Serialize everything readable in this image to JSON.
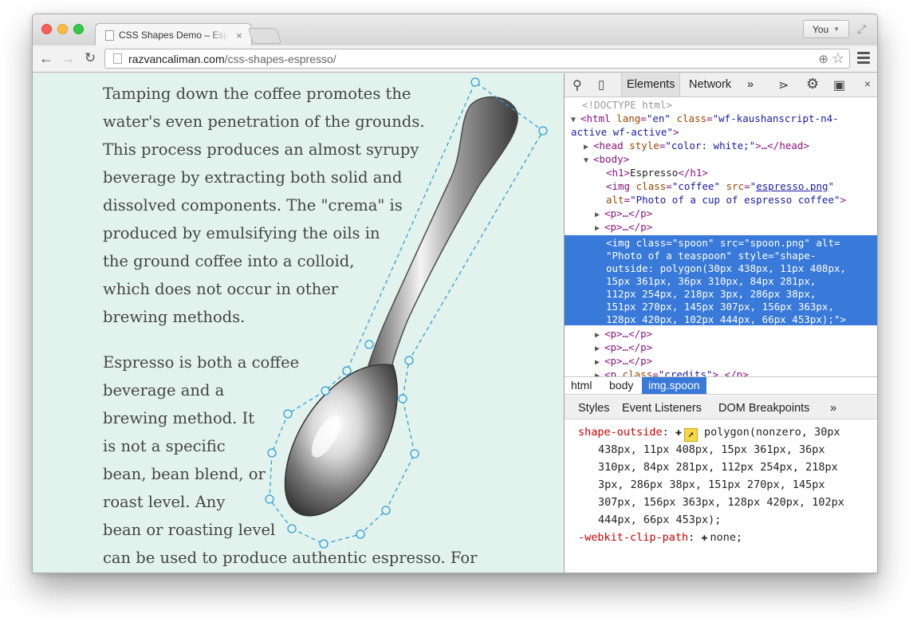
{
  "browser": {
    "tab_title": "CSS Shapes Demo – Espresso",
    "tab_close": "×",
    "profile_label": "You",
    "url_domain": "razvancaliman.com",
    "url_path": "/css-shapes-espresso/"
  },
  "article": {
    "p1_lines": [
      "Tamping down the coffee promotes the",
      "water's even penetration of the grounds.",
      "This process produces an almost syrupy",
      "beverage by extracting both solid and",
      "dissolved components. The \"crema\" is",
      "produced by emulsifying the oils in",
      "the ground coffee into a colloid,",
      "which does not occur in other",
      "brewing methods."
    ],
    "p2_lines": [
      "Espresso is both a coffee",
      "beverage and a",
      "brewing method. It",
      "is not a specific",
      "bean, bean blend, or",
      "roast level. Any",
      "bean or roasting level",
      "can be used to produce authentic espresso. For"
    ]
  },
  "devtools": {
    "tabs": [
      "Elements",
      "Network"
    ],
    "more": "»",
    "dom": {
      "doctype": "<!DOCTYPE html>",
      "html_open_1": "<html",
      "html_lang_attr": "lang",
      "html_lang_val": "\"en\"",
      "html_class_attr": "class",
      "html_class_val_1": "\"wf-kaushanscript-n4-",
      "html_class_val_2": "active wf-active\"",
      "head_open": "<head",
      "head_style_attr": "style",
      "head_style_val": "\"color: white;\"",
      "head_rest": ">…</head>",
      "body_open": "<body>",
      "h1_open": "<h1>",
      "h1_text": "Espresso",
      "h1_close": "</h1>",
      "img1_open": "<img",
      "img1_class_attr": "class",
      "img1_class_val": "\"coffee\"",
      "img1_src_attr": "src",
      "img1_src_val": "espresso.png",
      "img1_alt_attr": "alt",
      "img1_alt_val": "\"Photo of a cup of espresso coffee\"",
      "p_collapsed": "<p>…</p>",
      "sel_lines": [
        "<img class=\"spoon\" src=\"spoon.png\" alt=",
        "\"Photo of a teaspoon\" style=\"shape-",
        "outside: polygon(30px 438px, 11px 408px,",
        "15px 361px, 36px 310px, 84px 281px,",
        "112px 254px, 218px 3px, 286px 38px,",
        "151px 270px, 145px 307px, 156px 363px,",
        "128px 420px, 102px 444px, 66px 453px);\">"
      ],
      "p_credits_open": "<p",
      "p_credits_attr": "class",
      "p_credits_val": "\"credits\"",
      "p_credits_rest": ">…</p>"
    },
    "breadcrumbs": [
      "html",
      "body",
      "img.spoon"
    ],
    "style_tabs": [
      "Styles",
      "Event Listeners",
      "DOM Breakpoints"
    ],
    "styles": {
      "prop1": "shape-outside",
      "val1_lines": [
        "polygon(nonzero, 30px",
        "438px, 11px 408px, 15px 361px, 36px",
        "310px, 84px 281px, 112px 254px, 218px",
        "3px, 286px 38px, 151px 270px, 145px",
        "307px, 156px 363px, 128px 420px, 102px",
        "444px, 66px 453px);"
      ],
      "prop2": "-webkit-clip-path",
      "val2": "none;"
    }
  },
  "colors": {
    "page_bg": "#e2f3ee",
    "selection": "#3879d9",
    "shape_guide": "#2c9fd9"
  }
}
